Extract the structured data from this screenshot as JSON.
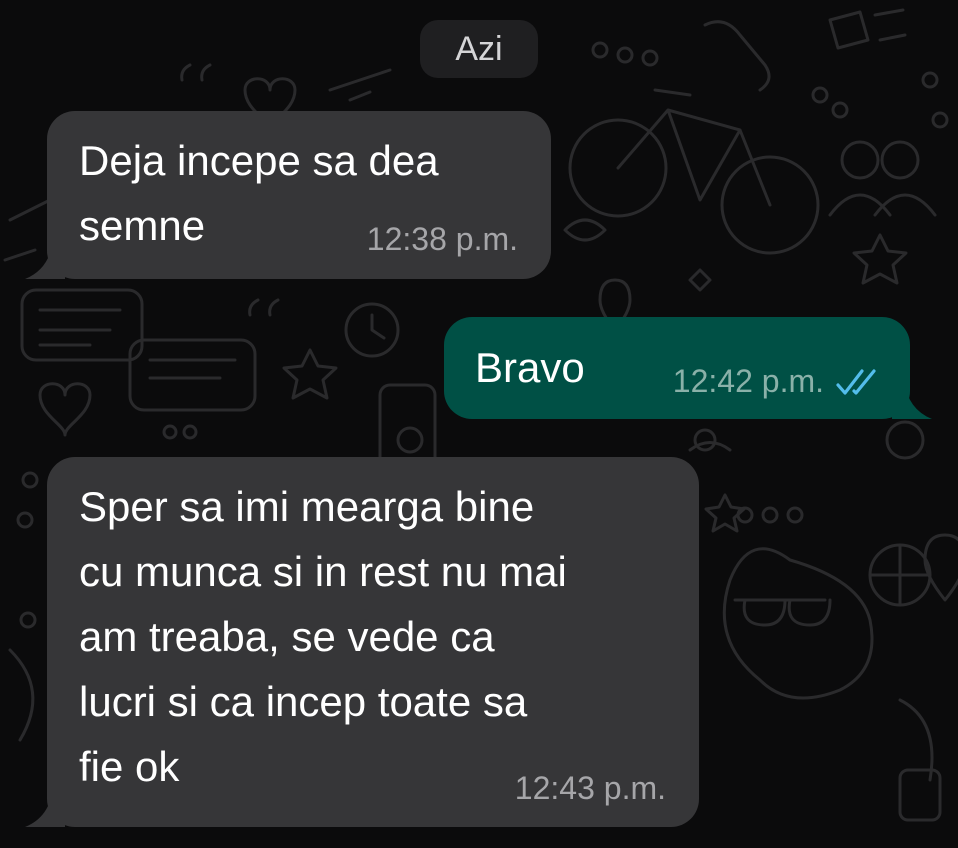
{
  "date_separator": "Azi",
  "messages": [
    {
      "direction": "incoming",
      "text": "Deja incepe sa dea\nsemne",
      "time": "12:38 p.m."
    },
    {
      "direction": "outgoing",
      "text": "Bravo",
      "time": "12:42 p.m.",
      "status": "read"
    },
    {
      "direction": "incoming",
      "text": "Sper sa imi mearga bine\ncu munca si in rest nu mai\nam treaba, se vede ca\nlucri si ca incep toate sa\nfie ok",
      "time": "12:43 p.m."
    }
  ],
  "colors": {
    "background": "#0b0b0c",
    "incoming_bubble": "#363638",
    "outgoing_bubble": "#005045",
    "read_ticks": "#53bdeb",
    "timestamp": "#a6a6a9",
    "date_pill": "#1f1f21"
  },
  "icons": {
    "read_receipt": "double-check-icon"
  }
}
